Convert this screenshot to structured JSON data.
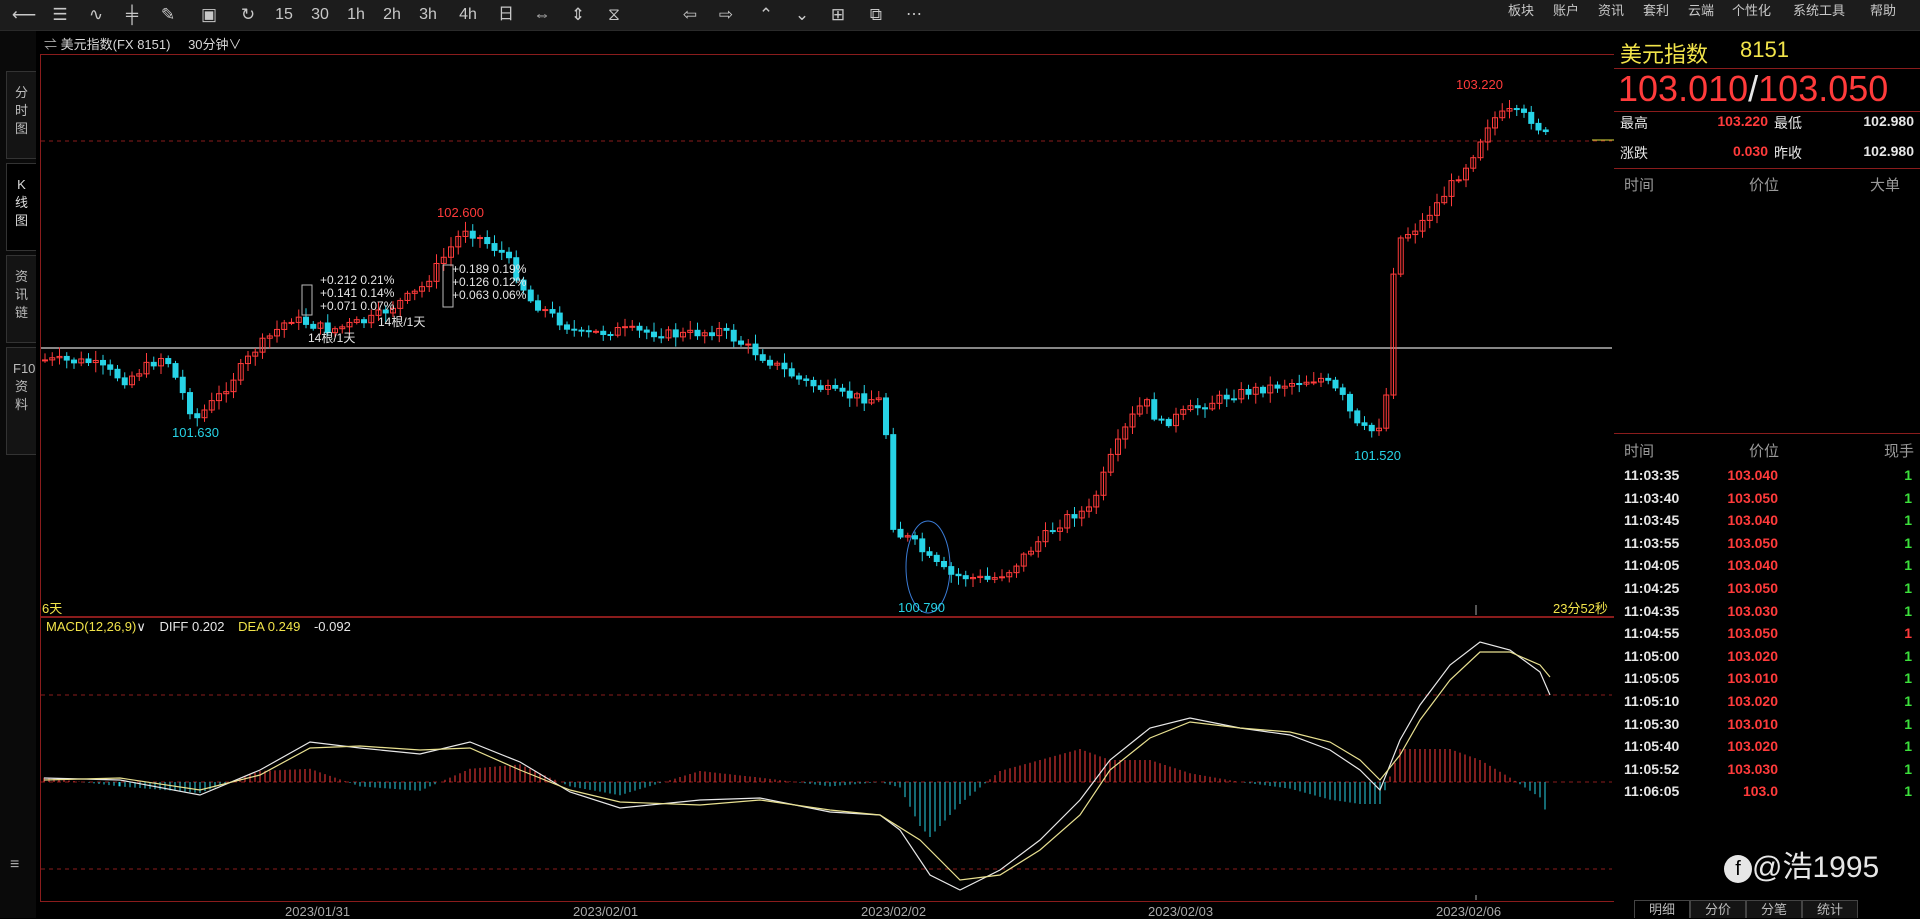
{
  "toolbar": {
    "timeframes": [
      "15",
      "30",
      "1h",
      "2h",
      "3h",
      "4h",
      "日"
    ],
    "more": "⋯",
    "menu": [
      "板块",
      "账户",
      "资讯",
      "套利",
      "云端",
      "个性化",
      "系统工具",
      "帮助"
    ]
  },
  "left_tabs": [
    {
      "label": "分时图"
    },
    {
      "label": "K线图",
      "active": true
    },
    {
      "label": "资讯链"
    },
    {
      "label": "F10资料"
    }
  ],
  "chart": {
    "symbol_title": "美元指数(FX 8151)",
    "period": "30分钟",
    "period_arrow": "∨",
    "label_days": "6天",
    "countdown": "23分52秒",
    "price_labels": {
      "high1": "102.600",
      "low1": "101.630",
      "low2": "100.790",
      "low3": "101.520",
      "high2": "103.220"
    },
    "measure_box1": {
      "lines": [
        "+0.212  0.21%",
        "+0.141  0.14%",
        "+0.071  0.07%"
      ],
      "foot": "14根/1天"
    },
    "measure_box2": {
      "lines": [
        "+0.189  0.19%",
        "+0.126  0.12%",
        "+0.063  0.06%"
      ],
      "foot": "14根/1天"
    },
    "x_dates": [
      "2023/01/31",
      "2023/02/01",
      "2023/02/02",
      "2023/02/03",
      "2023/02/06"
    ],
    "colors": {
      "up": "#ff3b3b",
      "down": "#27d3e6",
      "frame": "#8a1c1c",
      "diff": "#e8e8e8",
      "dea": "#e8e090"
    }
  },
  "macd": {
    "name": "MACD(12,26,9)",
    "arrow": "∨",
    "diff_label": "DIFF",
    "diff_value": "0.202",
    "dea_label": "DEA",
    "dea_value": "0.249",
    "macd_value": "-0.092"
  },
  "quote": {
    "name": "美元指数",
    "code": "8151",
    "bid": "103.010",
    "sep": "/",
    "ask": "103.050",
    "high_label": "最高",
    "high": "103.220",
    "low_label": "最低",
    "low": "102.980",
    "change_label": "涨跌",
    "change": "0.030",
    "prev_label": "昨收",
    "prev": "102.980",
    "bigorder_headers": [
      "时间",
      "价位",
      "大单"
    ],
    "tick_headers": [
      "时间",
      "价位",
      "现手"
    ],
    "ticks": [
      {
        "time": "11:03:35",
        "price": "103.040",
        "vol": "1",
        "dir": "up"
      },
      {
        "time": "11:03:40",
        "price": "103.050",
        "vol": "1",
        "dir": "up"
      },
      {
        "time": "11:03:45",
        "price": "103.040",
        "vol": "1",
        "dir": "up"
      },
      {
        "time": "11:03:55",
        "price": "103.050",
        "vol": "1",
        "dir": "up"
      },
      {
        "time": "11:04:05",
        "price": "103.040",
        "vol": "1",
        "dir": "up"
      },
      {
        "time": "11:04:25",
        "price": "103.050",
        "vol": "1",
        "dir": "up"
      },
      {
        "time": "11:04:35",
        "price": "103.030",
        "vol": "1",
        "dir": "up"
      },
      {
        "time": "11:04:55",
        "price": "103.050",
        "vol": "1",
        "dir": "down"
      },
      {
        "time": "11:05:00",
        "price": "103.020",
        "vol": "1",
        "dir": "up"
      },
      {
        "time": "11:05:05",
        "price": "103.010",
        "vol": "1",
        "dir": "up"
      },
      {
        "time": "11:05:10",
        "price": "103.020",
        "vol": "1",
        "dir": "up"
      },
      {
        "time": "11:05:30",
        "price": "103.010",
        "vol": "1",
        "dir": "up"
      },
      {
        "time": "11:05:40",
        "price": "103.020",
        "vol": "1",
        "dir": "up"
      },
      {
        "time": "11:05:52",
        "price": "103.030",
        "vol": "1",
        "dir": "up"
      },
      {
        "time": "11:06:05",
        "price": "103.0",
        "vol": "1",
        "dir": "up"
      }
    ],
    "bottom_tabs": [
      "明细",
      "分价",
      "分笔",
      "统计"
    ],
    "watermark": "@浩1995"
  }
}
